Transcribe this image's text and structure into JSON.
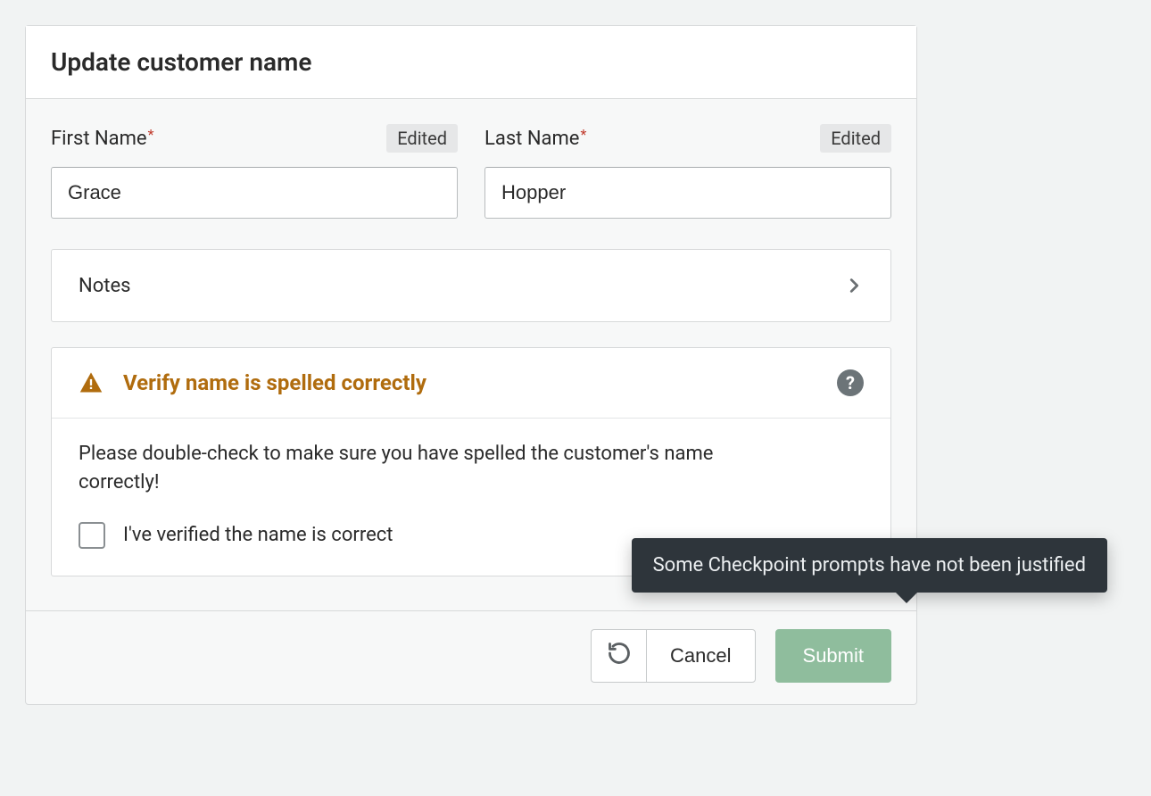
{
  "header": {
    "title": "Update customer name"
  },
  "fields": {
    "first_name": {
      "label": "First Name",
      "value": "Grace",
      "badge": "Edited",
      "required_mark": "*"
    },
    "last_name": {
      "label": "Last Name",
      "value": "Hopper",
      "badge": "Edited",
      "required_mark": "*"
    }
  },
  "notes": {
    "label": "Notes"
  },
  "verify": {
    "title": "Verify name is spelled correctly",
    "body": "Please double-check to make sure you have spelled the customer's name correctly!",
    "checkbox_label": "I've verified the name is correct",
    "help_glyph": "?"
  },
  "footer": {
    "cancel": "Cancel",
    "submit": "Submit"
  },
  "tooltip": {
    "text": "Some Checkpoint prompts have not been justified"
  }
}
